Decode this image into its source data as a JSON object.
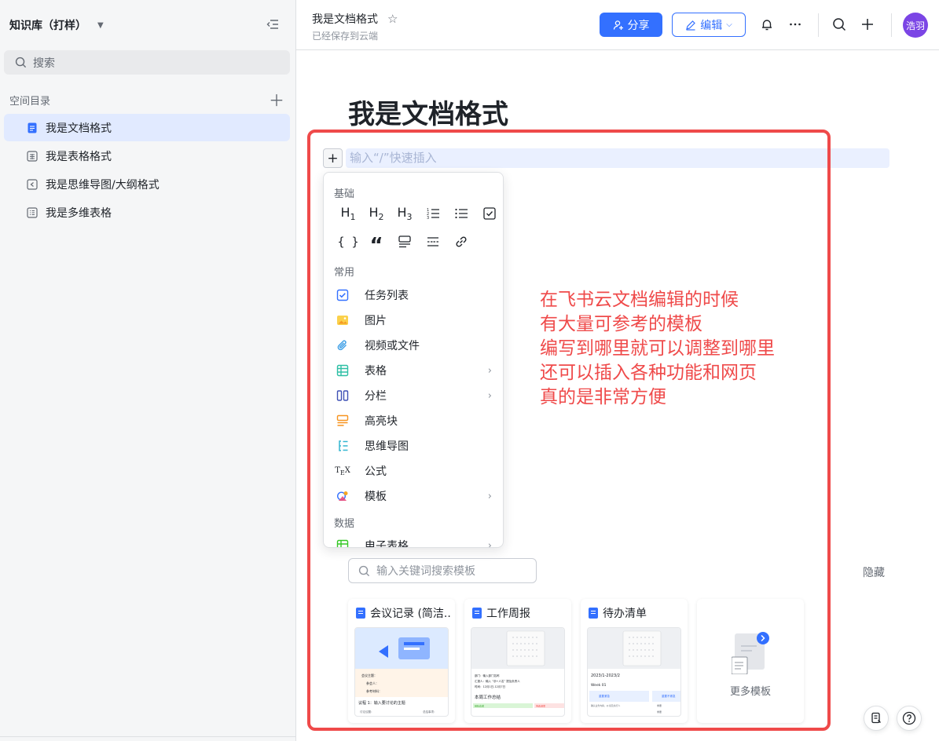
{
  "sidebar": {
    "title": "知识库（打样）",
    "search_placeholder": "搜索",
    "section_label": "空间目录",
    "items": [
      {
        "label": "我是文档格式",
        "icon": "doc-icon",
        "active": true
      },
      {
        "label": "我是表格格式",
        "icon": "sheet-icon",
        "active": false
      },
      {
        "label": "我是思维导图/大纲格式",
        "icon": "mindmap-icon",
        "active": false
      },
      {
        "label": "我是多维表格",
        "icon": "bitable-icon",
        "active": false
      }
    ]
  },
  "header": {
    "doc_title": "我是文档格式",
    "saved_status": "已经保存到云端",
    "share_label": "分享",
    "edit_label": "编辑",
    "avatar_text": "浩羽"
  },
  "document": {
    "heading": "我是文档格式",
    "insert_placeholder": "输入“/”快速插入"
  },
  "insert_menu": {
    "sections": {
      "basic": "基础",
      "common": "常用",
      "data": "数据"
    },
    "basic_icons": [
      "h1-icon",
      "h2-icon",
      "h3-icon",
      "ordered-list-icon",
      "bullet-list-icon",
      "checkbox-icon",
      "code-block-icon",
      "quote-icon",
      "callout-icon",
      "divider-icon",
      "link-icon"
    ],
    "common_items": [
      {
        "label": "任务列表",
        "icon": "task-list-icon",
        "color": "#3370ff",
        "submenu": false
      },
      {
        "label": "图片",
        "icon": "image-icon",
        "color": "#f5a623",
        "submenu": false
      },
      {
        "label": "视频或文件",
        "icon": "attachment-icon",
        "color": "#3e9fe6",
        "submenu": false
      },
      {
        "label": "表格",
        "icon": "table-icon",
        "color": "#2ebfa5",
        "submenu": true
      },
      {
        "label": "分栏",
        "icon": "columns-icon",
        "color": "#3f51b5",
        "submenu": true
      },
      {
        "label": "高亮块",
        "icon": "highlight-block-icon",
        "color": "#f7931e",
        "submenu": false
      },
      {
        "label": "思维导图",
        "icon": "mindmap-icon",
        "color": "#34b6d1",
        "submenu": false
      },
      {
        "label": "公式",
        "icon": "tex-icon",
        "color": "#1f2329",
        "submenu": false
      },
      {
        "label": "模板",
        "icon": "template-icon",
        "color": "#e94c7c",
        "submenu": true
      }
    ],
    "data_items": [
      {
        "label": "电子表格",
        "icon": "spreadsheet-icon",
        "color": "#34c724",
        "submenu": true
      }
    ]
  },
  "annotation": {
    "lines": [
      "在飞书云文档编辑的时候",
      "有大量可参考的模板",
      "编写到哪里就可以调整到哪里",
      "还可以插入各种功能和网页",
      "真的是非常方便"
    ],
    "color": "#ef4a4a"
  },
  "templates": {
    "search_placeholder": "输入关键词搜索模板",
    "hide_label": "隐藏",
    "cards": [
      {
        "title": "会议记录 (简洁...",
        "preview": {
          "lines": [
            "会议主题：",
            "参会人：",
            "参考材料：",
            "议程 1：输入要讨论的主题",
            "讨论议题：",
            "总结事项："
          ]
        }
      },
      {
        "title": "工作周报",
        "preview": {
          "lines": [
            "部门：输入部门名称",
            "汇报人：输入 “@+人名” 提及负责人",
            "时间：12月1日-12月7日",
            "本周工作总结",
            "目标达成",
            "待改进项"
          ]
        }
      },
      {
        "title": "待办清单",
        "preview": {
          "lines": [
            "2023/1-2023/2",
            "Week 01",
            "重要紧急",
            "重要不紧急",
            "确认业务内容，@ 提及执行人",
            "重要",
            "重要"
          ]
        }
      }
    ],
    "more_label": "更多模板"
  }
}
